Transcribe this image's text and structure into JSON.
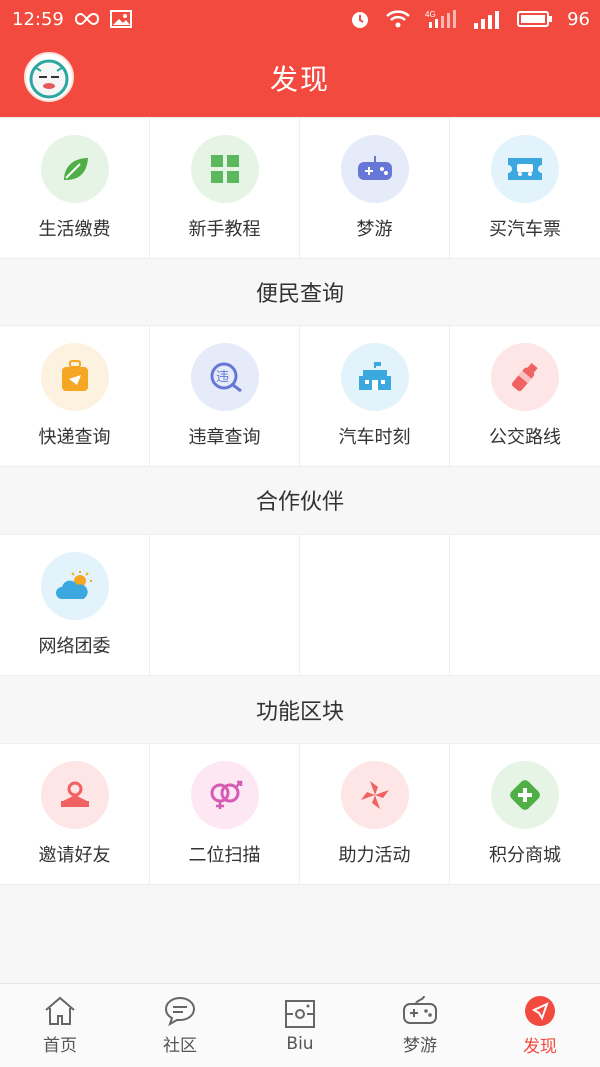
{
  "status_bar": {
    "time": "12:59",
    "battery": "96",
    "network": "4G"
  },
  "header": {
    "title": "发现"
  },
  "sections": [
    {
      "title": "",
      "items": [
        {
          "label": "生活缴费",
          "icon": "leaf-icon",
          "color": "#e6f4e5"
        },
        {
          "label": "新手教程",
          "icon": "grid-icon",
          "color": "#e6f4e5"
        },
        {
          "label": "梦游",
          "icon": "gamepad-icon",
          "color": "#e6ebfa"
        },
        {
          "label": "买汽车票",
          "icon": "bus-ticket-icon",
          "color": "#e3f3fb"
        }
      ]
    },
    {
      "title": "便民查询",
      "items": [
        {
          "label": "快递查询",
          "icon": "luggage-icon",
          "color": "#fdf1e0"
        },
        {
          "label": "违章查询",
          "icon": "violation-search-icon",
          "color": "#e6ebfa"
        },
        {
          "label": "汽车时刻",
          "icon": "station-icon",
          "color": "#e3f3fb"
        },
        {
          "label": "公交路线",
          "icon": "bottle-icon",
          "color": "#fde6e5"
        }
      ]
    },
    {
      "title": "合作伙伴",
      "items": [
        {
          "label": "网络团委",
          "icon": "weather-icon",
          "color": "#e3f3fb"
        }
      ]
    },
    {
      "title": "功能区块",
      "items": [
        {
          "label": "邀请好友",
          "icon": "ring-icon",
          "color": "#fde6e5"
        },
        {
          "label": "二位扫描",
          "icon": "gender-rings-icon",
          "color": "#fde7f3"
        },
        {
          "label": "助力活动",
          "icon": "pinwheel-icon",
          "color": "#fde6e5"
        },
        {
          "label": "积分商城",
          "icon": "plus-cross-icon",
          "color": "#e6f4e5"
        }
      ]
    }
  ],
  "bottom_nav": [
    {
      "label": "首页",
      "icon": "home-icon",
      "active": false
    },
    {
      "label": "社区",
      "icon": "chat-bubble-icon",
      "active": false
    },
    {
      "label": "Biu",
      "icon": "camera-frame-icon",
      "active": false
    },
    {
      "label": "梦游",
      "icon": "gamepad-icon",
      "active": false
    },
    {
      "label": "发现",
      "icon": "compass-icon",
      "active": true
    }
  ],
  "colors": {
    "brand_red": "#f24a3f",
    "active": "#f24a3f"
  }
}
